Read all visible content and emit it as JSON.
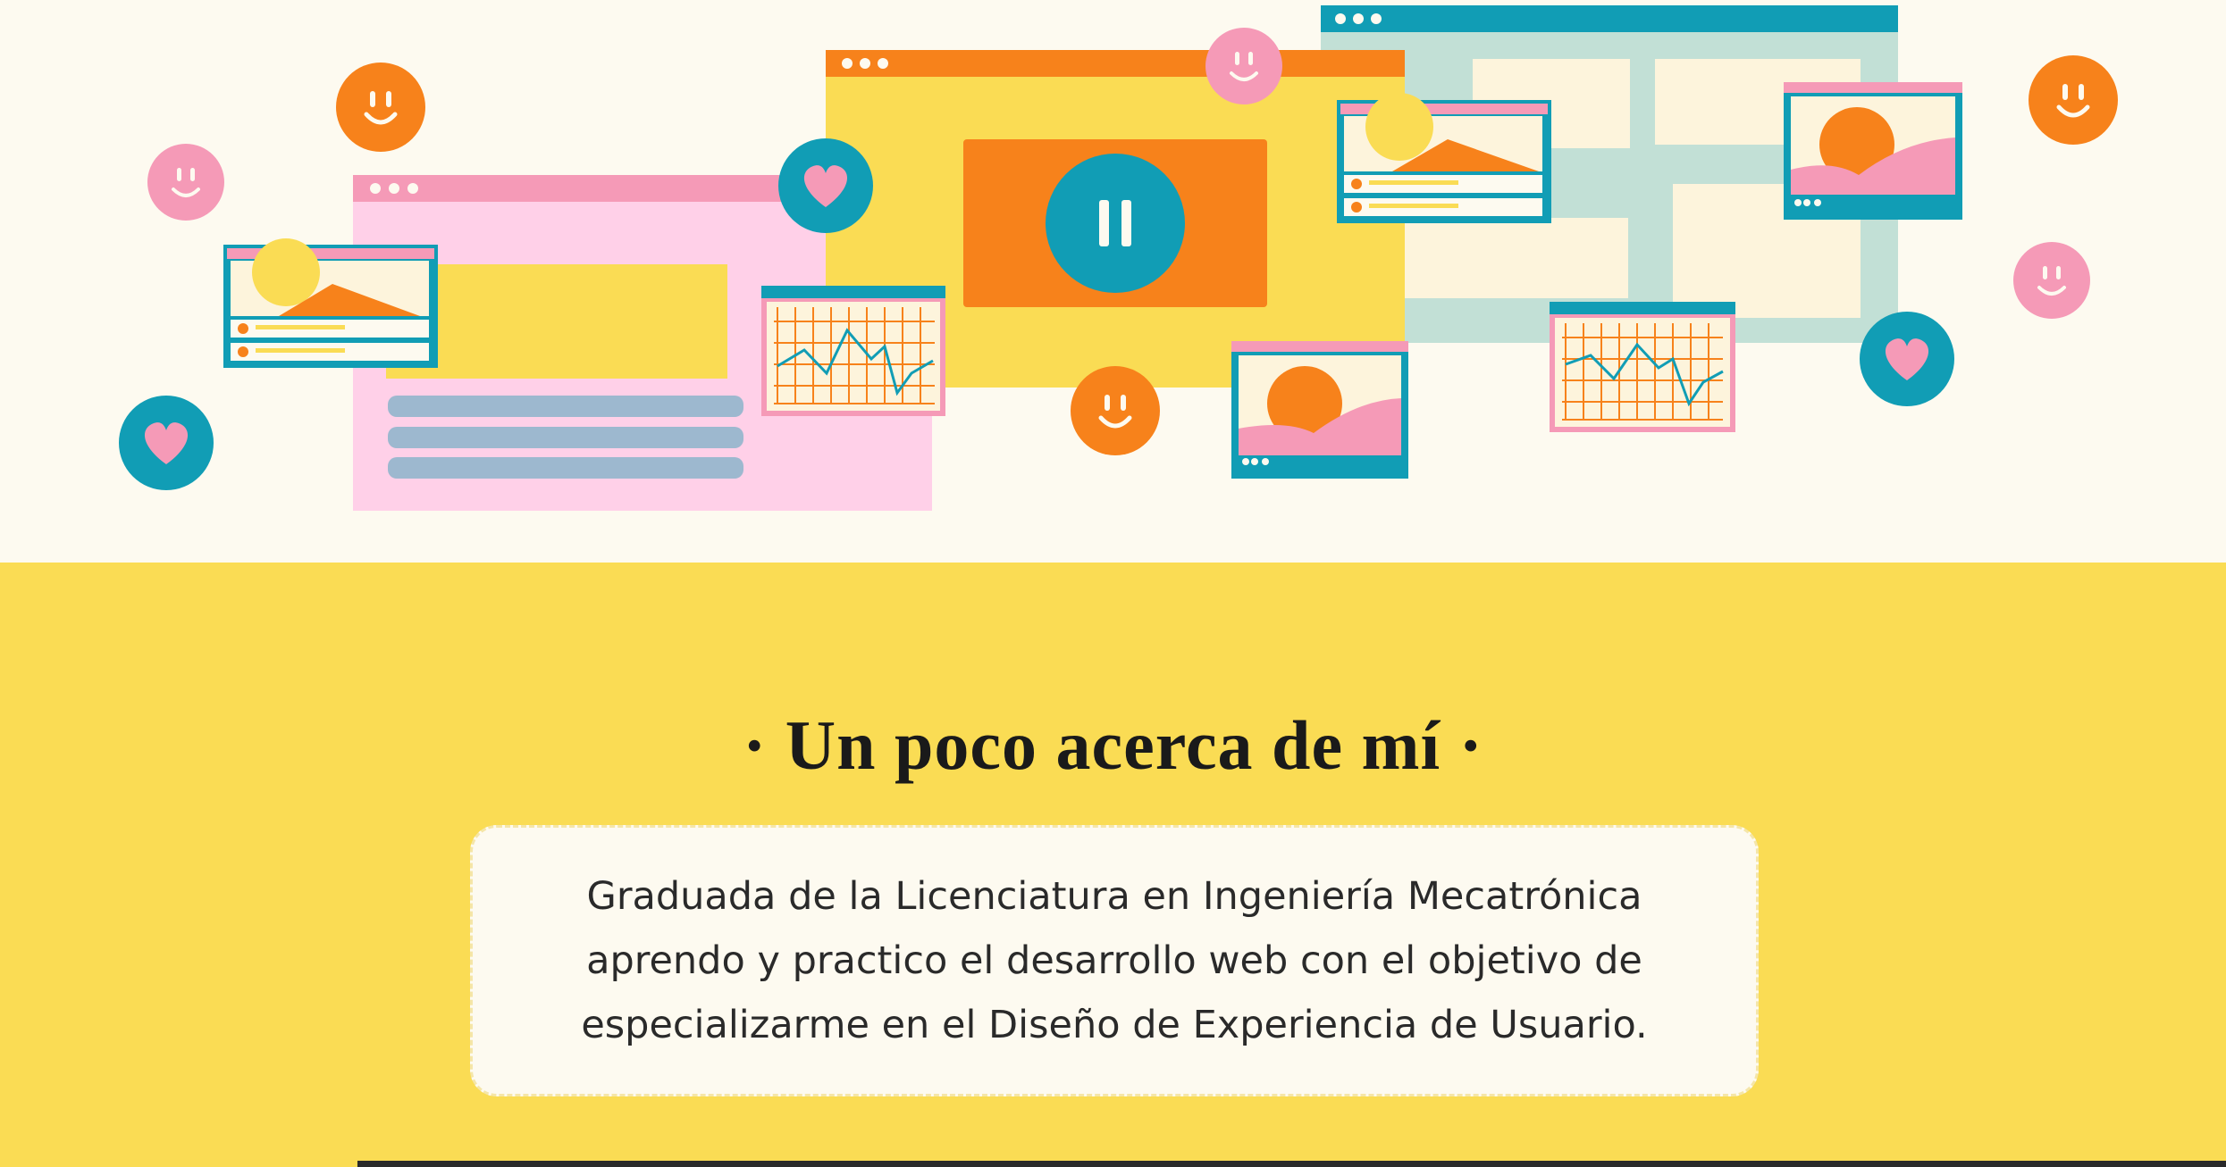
{
  "hero": {
    "illustration": "web-design-collage",
    "colors": {
      "cream": "#fdfaf0",
      "yellow": "#fadc54",
      "orange": "#f7821b",
      "teal": "#119db5",
      "pink": "#f59ab7",
      "light_pink": "#ffd0e8",
      "mint": "#c2e0d6",
      "blue_gray": "#9db8cf"
    }
  },
  "about": {
    "title": "· Un poco acerca de mí ·",
    "body": "Graduada de la Licenciatura en Ingeniería Mecatrónica aprendo y practico el desarrollo web con el objetivo de especializarme en el Diseño de Experiencia de Usuario."
  }
}
